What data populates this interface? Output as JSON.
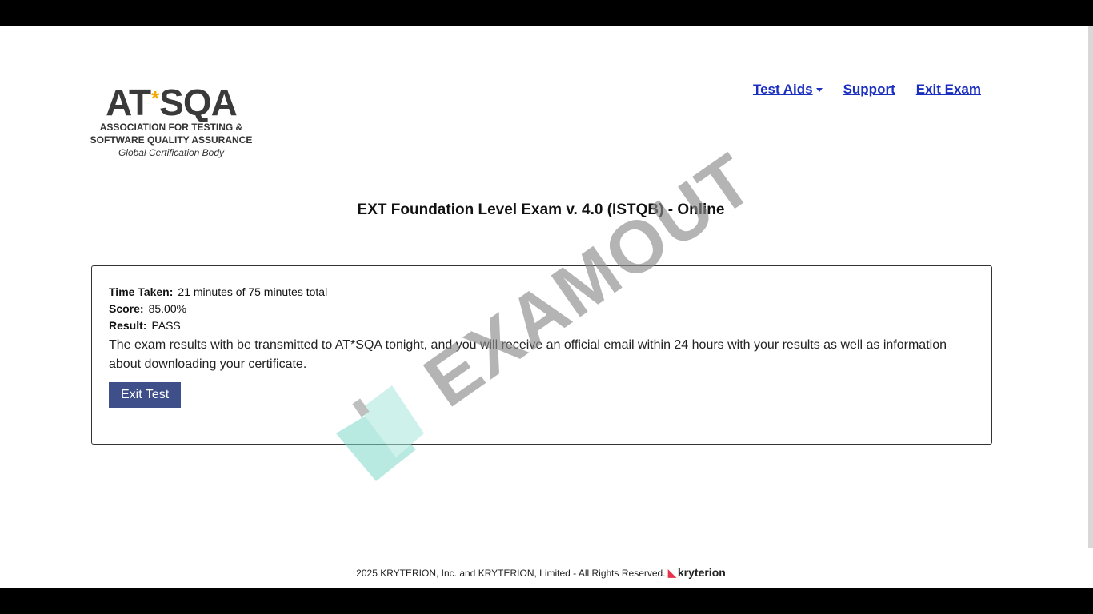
{
  "logo": {
    "mark_left": "AT",
    "mark_star": "*",
    "mark_right": "SQA",
    "line1": "ASSOCIATION FOR TESTING &",
    "line2": "SOFTWARE QUALITY ASSURANCE",
    "tagline": "Global Certification Body"
  },
  "nav": {
    "test_aids": "Test Aids",
    "support": "Support",
    "exit_exam": "Exit Exam"
  },
  "exam": {
    "title": "EXT Foundation Level Exam v. 4.0 (ISTQB) - Online"
  },
  "result": {
    "time_label": "Time Taken:",
    "time_value": "21 minutes of 75 minutes total",
    "score_label": "Score:",
    "score_value": "85.00%",
    "result_label": "Result:",
    "result_value": "PASS",
    "message": "The exam results with be transmitted to AT*SQA tonight, and you will receive an official email within 24 hours with your results as well as information about downloading your certificate.",
    "exit_button": "Exit Test"
  },
  "watermark": {
    "text": "EXAMOUT"
  },
  "footer": {
    "copyright": "2025 KRYTERION, Inc. and KRYTERION, Limited - All Rights Reserved.",
    "brand": "kryterion"
  },
  "colors": {
    "link": "#1a2fbf",
    "button": "#3e4f89",
    "logo_star": "#f2a900",
    "watermark_gray": "#8c8c8c",
    "watermark_teal": "#7fd9c9"
  }
}
